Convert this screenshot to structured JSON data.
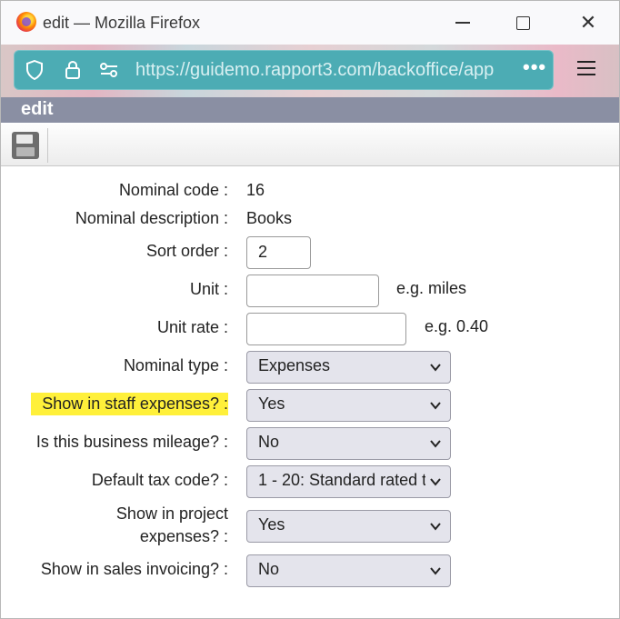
{
  "window": {
    "title": "edit — Mozilla Firefox"
  },
  "browser": {
    "url": "https://guidemo.rapport3.com/backoffice/app",
    "more_label": "•••"
  },
  "app": {
    "header_title": "edit"
  },
  "form": {
    "nominal_code": {
      "label": "Nominal code :",
      "value": "16"
    },
    "nominal_description": {
      "label": "Nominal description :",
      "value": "Books"
    },
    "sort_order": {
      "label": "Sort order :",
      "value": "2"
    },
    "unit": {
      "label": "Unit :",
      "value": "",
      "hint": "e.g. miles"
    },
    "unit_rate": {
      "label": "Unit rate :",
      "value": "",
      "hint": "e.g. 0.40"
    },
    "nominal_type": {
      "label": "Nominal type :",
      "value": "Expenses"
    },
    "show_in_staff_expenses": {
      "label": "Show in staff expenses? :",
      "value": "Yes"
    },
    "business_mileage": {
      "label": "Is this business mileage? :",
      "value": "No"
    },
    "default_tax_code": {
      "label": "Default tax code? :",
      "value": "1 - 20: Standard rated t"
    },
    "show_in_project_expenses": {
      "label_line1": "Show in project",
      "label_line2": "expenses? :",
      "value": "Yes"
    },
    "show_in_sales_invoicing": {
      "label": "Show in sales invoicing? :",
      "value": "No"
    }
  },
  "colors": {
    "highlight": "#fff03a",
    "header_bg": "#8a8fa3",
    "urlbar_bg": "#4cacb4"
  }
}
